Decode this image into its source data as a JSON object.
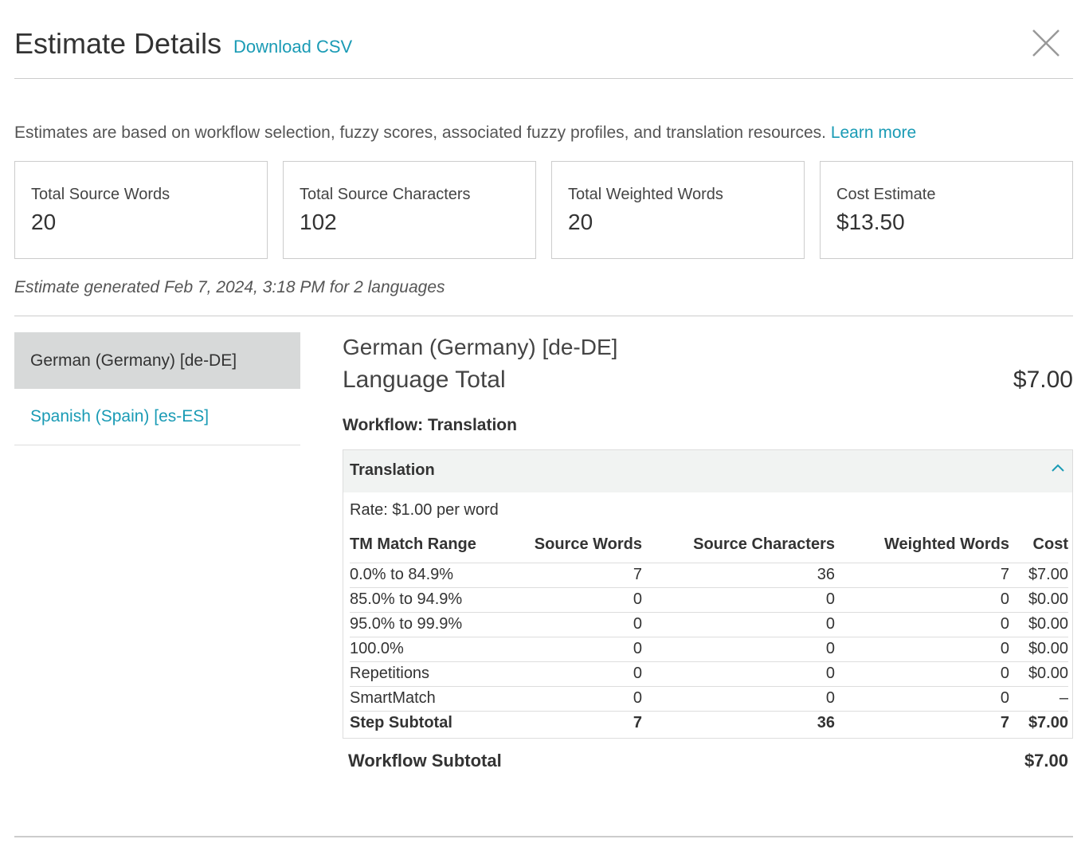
{
  "header": {
    "title": "Estimate Details",
    "download_label": "Download CSV"
  },
  "description": {
    "text": "Estimates are based on workflow selection, fuzzy scores, associated fuzzy profiles, and translation resources.",
    "learn_more": "Learn more"
  },
  "summary_cards": [
    {
      "label": "Total Source Words",
      "value": "20"
    },
    {
      "label": "Total Source Characters",
      "value": "102"
    },
    {
      "label": "Total Weighted Words",
      "value": "20"
    },
    {
      "label": "Cost Estimate",
      "value": "$13.50"
    }
  ],
  "generated_text": "Estimate generated Feb 7, 2024, 3:18 PM for 2 languages",
  "sidebar": {
    "items": [
      {
        "label": "German (Germany) [de-DE]",
        "active": true
      },
      {
        "label": "Spanish (Spain) [es-ES]",
        "active": false
      }
    ]
  },
  "detail": {
    "language_name": "German (Germany) [de-DE]",
    "language_total_label": "Language Total",
    "language_total_value": "$7.00",
    "workflow_title": "Workflow: Translation",
    "panel_title": "Translation",
    "rate": "Rate: $1.00 per word",
    "columns": [
      "TM Match Range",
      "Source Words",
      "Source Characters",
      "Weighted Words",
      "Cost"
    ],
    "rows": [
      [
        "0.0% to 84.9%",
        "7",
        "36",
        "7",
        "$7.00"
      ],
      [
        "85.0% to 94.9%",
        "0",
        "0",
        "0",
        "$0.00"
      ],
      [
        "95.0% to 99.9%",
        "0",
        "0",
        "0",
        "$0.00"
      ],
      [
        "100.0%",
        "0",
        "0",
        "0",
        "$0.00"
      ],
      [
        "Repetitions",
        "0",
        "0",
        "0",
        "$0.00"
      ],
      [
        "SmartMatch",
        "0",
        "0",
        "0",
        "–"
      ],
      [
        "Step Subtotal",
        "7",
        "36",
        "7",
        "$7.00"
      ]
    ],
    "workflow_subtotal_label": "Workflow Subtotal",
    "workflow_subtotal_value": "$7.00"
  },
  "colors": {
    "accent": "#1a9bb5",
    "active_bg": "#d7d9d9",
    "panel_header_bg": "#f1f3f2"
  }
}
